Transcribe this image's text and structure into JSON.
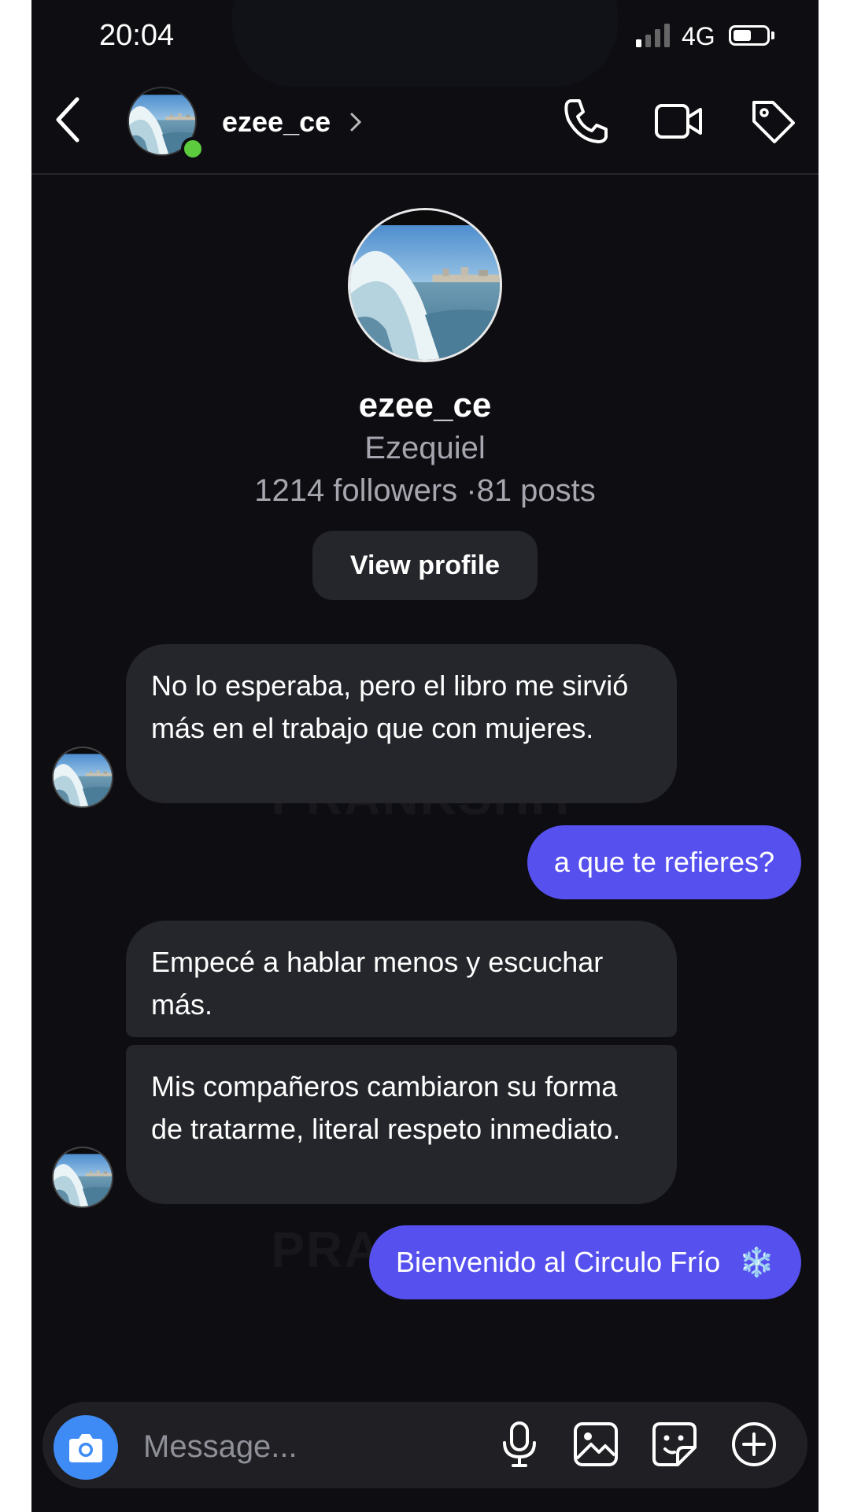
{
  "status_bar": {
    "time": "20:04",
    "network": "4G",
    "battery_level": 0.55
  },
  "header": {
    "username": "ezee_ce",
    "icons": [
      "back-arrow-icon",
      "chevron-right-icon",
      "phone-icon",
      "video-camera-icon",
      "tag-icon"
    ],
    "online": true
  },
  "profile": {
    "username": "ezee_ce",
    "full_name": "Ezequiel",
    "stats": "1214 followers ·81 posts",
    "view_profile_label": "View profile"
  },
  "watermark": "PRANKSHIT",
  "messages": [
    {
      "direction": "in",
      "text": "No lo esperaba, pero el libro me sirvió más en el trabajo que con mujeres."
    },
    {
      "direction": "out",
      "text": "a que te refieres?"
    },
    {
      "direction": "in",
      "text": "Empecé a hablar menos y escuchar más."
    },
    {
      "direction": "in",
      "text": "Mis compañeros cambiaron su forma de tratarme, literal respeto inmediato."
    },
    {
      "direction": "out",
      "text": "Bienvenido al Circulo Frío",
      "emoji": "❄️"
    }
  ],
  "composer": {
    "placeholder": "Message...",
    "icons": [
      "camera-icon",
      "microphone-icon",
      "gallery-icon",
      "sticker-icon",
      "plus-circle-icon"
    ]
  },
  "colors": {
    "background": "#0d0d12",
    "incoming_bubble": "#25262b",
    "outgoing_bubble": "#5650ef",
    "camera_button": "#3e8bf5",
    "online_dot": "#5ccc3e"
  }
}
